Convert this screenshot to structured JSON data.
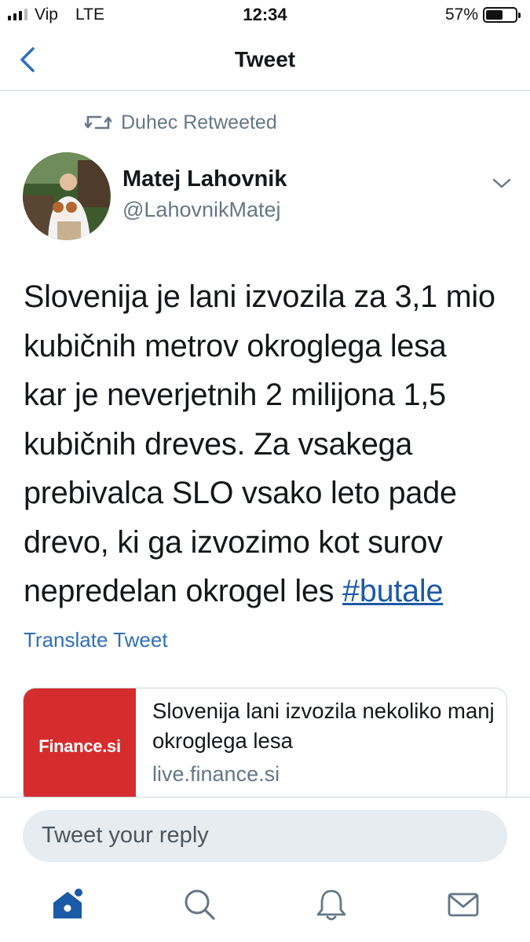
{
  "status_bar": {
    "carrier": "Vip",
    "network": "LTE",
    "time": "12:34",
    "battery_percent": "57%",
    "battery_level": 0.57,
    "signal_bars": 3
  },
  "nav": {
    "title": "Tweet",
    "back_icon": "chevron-left-icon"
  },
  "retweet": {
    "text": "Duhec Retweeted",
    "icon": "retweet-icon"
  },
  "author": {
    "name": "Matej Lahovnik",
    "handle": "@LahovnikMatej"
  },
  "tweet": {
    "lines": [
      "Slovenija je lani izvozila za 3,1 mio",
      "kubičnih metrov okroglega lesa",
      "kar je neverjetnih 2 milijona 1,5",
      "kubičnih dreves. Za vsakega",
      "prebivalca SLO vsako leto pade",
      "drevo, ki ga izvozimo kot surov"
    ],
    "last_line": "nepredelan okrogel les ",
    "hashtag": "#butale",
    "translate_label": "Translate Tweet"
  },
  "link_card": {
    "thumb_text": "Finance.si",
    "title": "Slovenija lani izvozila nekoliko manj okroglega lesa",
    "domain": "live.finance.si"
  },
  "reply": {
    "placeholder": "Tweet your reply"
  },
  "tab_bar": {
    "tabs": [
      "home-icon",
      "search-icon",
      "notifications-icon",
      "messages-icon"
    ],
    "accent": "#1b5aa6"
  },
  "colors": {
    "link": "#2e6fbd",
    "muted": "#657786",
    "card_thumb": "#d52d2f"
  }
}
